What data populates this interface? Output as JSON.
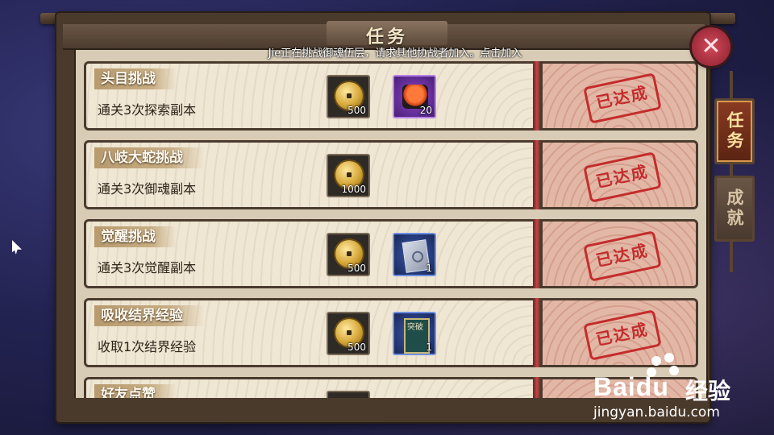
{
  "window": {
    "title": "任务"
  },
  "notice": "Jie正在挑战御魂伍层，请求其他协战者加入。点击加入",
  "tabs": [
    {
      "label": "任务",
      "active": true
    },
    {
      "label": "成就",
      "active": false
    }
  ],
  "close_icon": "close-x-icon",
  "tasks": [
    {
      "name": "头目挑战",
      "desc": "通关3次探索副本",
      "rewards": [
        {
          "icon": "gold-coin-icon",
          "count": "500"
        },
        {
          "icon": "sushi-icon",
          "count": "20"
        }
      ],
      "status": "已达成"
    },
    {
      "name": "八岐大蛇挑战",
      "desc": "通关3次御魂副本",
      "rewards": [
        {
          "icon": "gold-coin-icon",
          "count": "1000"
        }
      ],
      "status": "已达成"
    },
    {
      "name": "觉醒挑战",
      "desc": "通关3次觉醒副本",
      "rewards": [
        {
          "icon": "gold-coin-icon",
          "count": "500"
        },
        {
          "icon": "ticket-icon",
          "count": "1"
        }
      ],
      "status": "已达成"
    },
    {
      "name": "吸收结界经验",
      "desc": "收取1次结界经验",
      "rewards": [
        {
          "icon": "gold-coin-icon",
          "count": "500"
        },
        {
          "icon": "breakthrough-scroll-icon",
          "count": "1",
          "label": "突破"
        }
      ],
      "status": "已达成"
    },
    {
      "name": "好友点赞",
      "desc": "",
      "rewards": [],
      "status": ""
    }
  ],
  "watermark": {
    "brand": "Bai",
    "brand2": "du",
    "cn": "经验",
    "url": "jingyan.baidu.com"
  },
  "colors": {
    "stamp": "#c42c2c",
    "frame": "#4a3a2c",
    "active_tab": "#8a3a22"
  }
}
